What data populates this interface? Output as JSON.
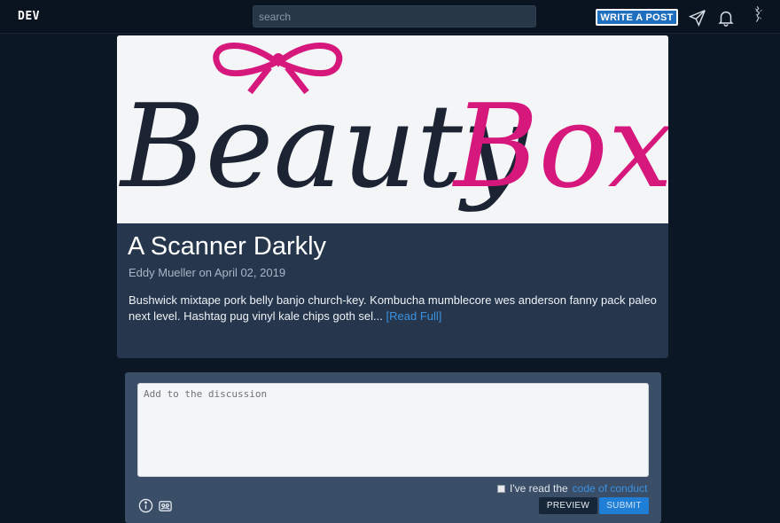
{
  "nav": {
    "logo": "DEV",
    "search_placeholder": "search",
    "write_post_label": "WRITE A POST",
    "icons": [
      "paper-plane-icon",
      "bell-icon",
      "user-avatar"
    ]
  },
  "article": {
    "cover_text": {
      "word1": "Beauty",
      "word2": "Box"
    },
    "title": "A Scanner Darkly",
    "byline": "Eddy Mueller on April 02, 2019",
    "excerpt": "Bushwick mixtape pork belly banjo church-key. Kombucha mumblecore wes anderson fanny pack paleo next level. Hashtag pug vinyl kale chips goth sel...",
    "read_full_label": "[Read Full]"
  },
  "discussion": {
    "placeholder": "Add to the discussion",
    "coc_prefix": "I've read the",
    "coc_link": "code of conduct",
    "preview_label": "PREVIEW",
    "submit_label": "SUBMIT",
    "icons": [
      "info-icon",
      "image-upload-icon"
    ]
  },
  "colors": {
    "background": "#0c1725",
    "card": "#25364d",
    "accent": "#1f7fd6",
    "brand_dark": "#1c2433",
    "brand_pink": "#d6177c"
  }
}
